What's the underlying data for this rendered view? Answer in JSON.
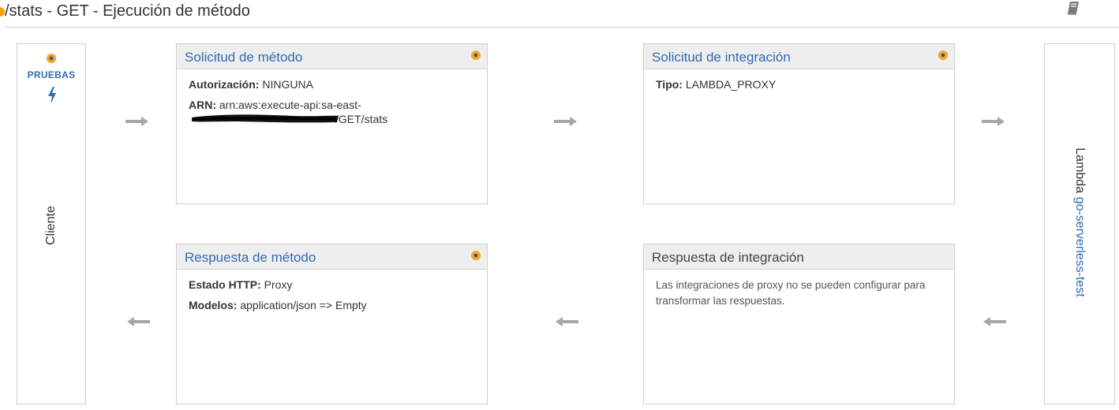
{
  "header": {
    "title": "/stats - GET - Ejecución de método",
    "docs_icon": "book-icon"
  },
  "client": {
    "test_label": "PRUEBAS",
    "test_icon": "lightning-bolt-icon",
    "label": "Cliente"
  },
  "method_request": {
    "title": "Solicitud de método",
    "auth_label": "Autorización:",
    "auth_value": "NINGUNA",
    "arn_label": "ARN:",
    "arn_line1": "arn:aws:execute-api:sa-east-",
    "arn_line2_tail": "/GET/stats"
  },
  "integration_request": {
    "title": "Solicitud de integración",
    "type_label": "Tipo:",
    "type_value": "LAMBDA_PROXY"
  },
  "method_response": {
    "title": "Respuesta de método",
    "status_label": "Estado HTTP:",
    "status_value": "Proxy",
    "models_label": "Modelos:",
    "models_value": "application/json => Empty"
  },
  "integration_response": {
    "title": "Respuesta de integración",
    "note": "Las integraciones de proxy no se pueden configurar para transformar las respuestas."
  },
  "lambda": {
    "prefix": "Lambda",
    "function_name": "go-serverless-test"
  },
  "colors": {
    "link": "#2f6cb2",
    "accent_orange": "#f8a01c",
    "arrow_gray": "#a6a6a6"
  }
}
